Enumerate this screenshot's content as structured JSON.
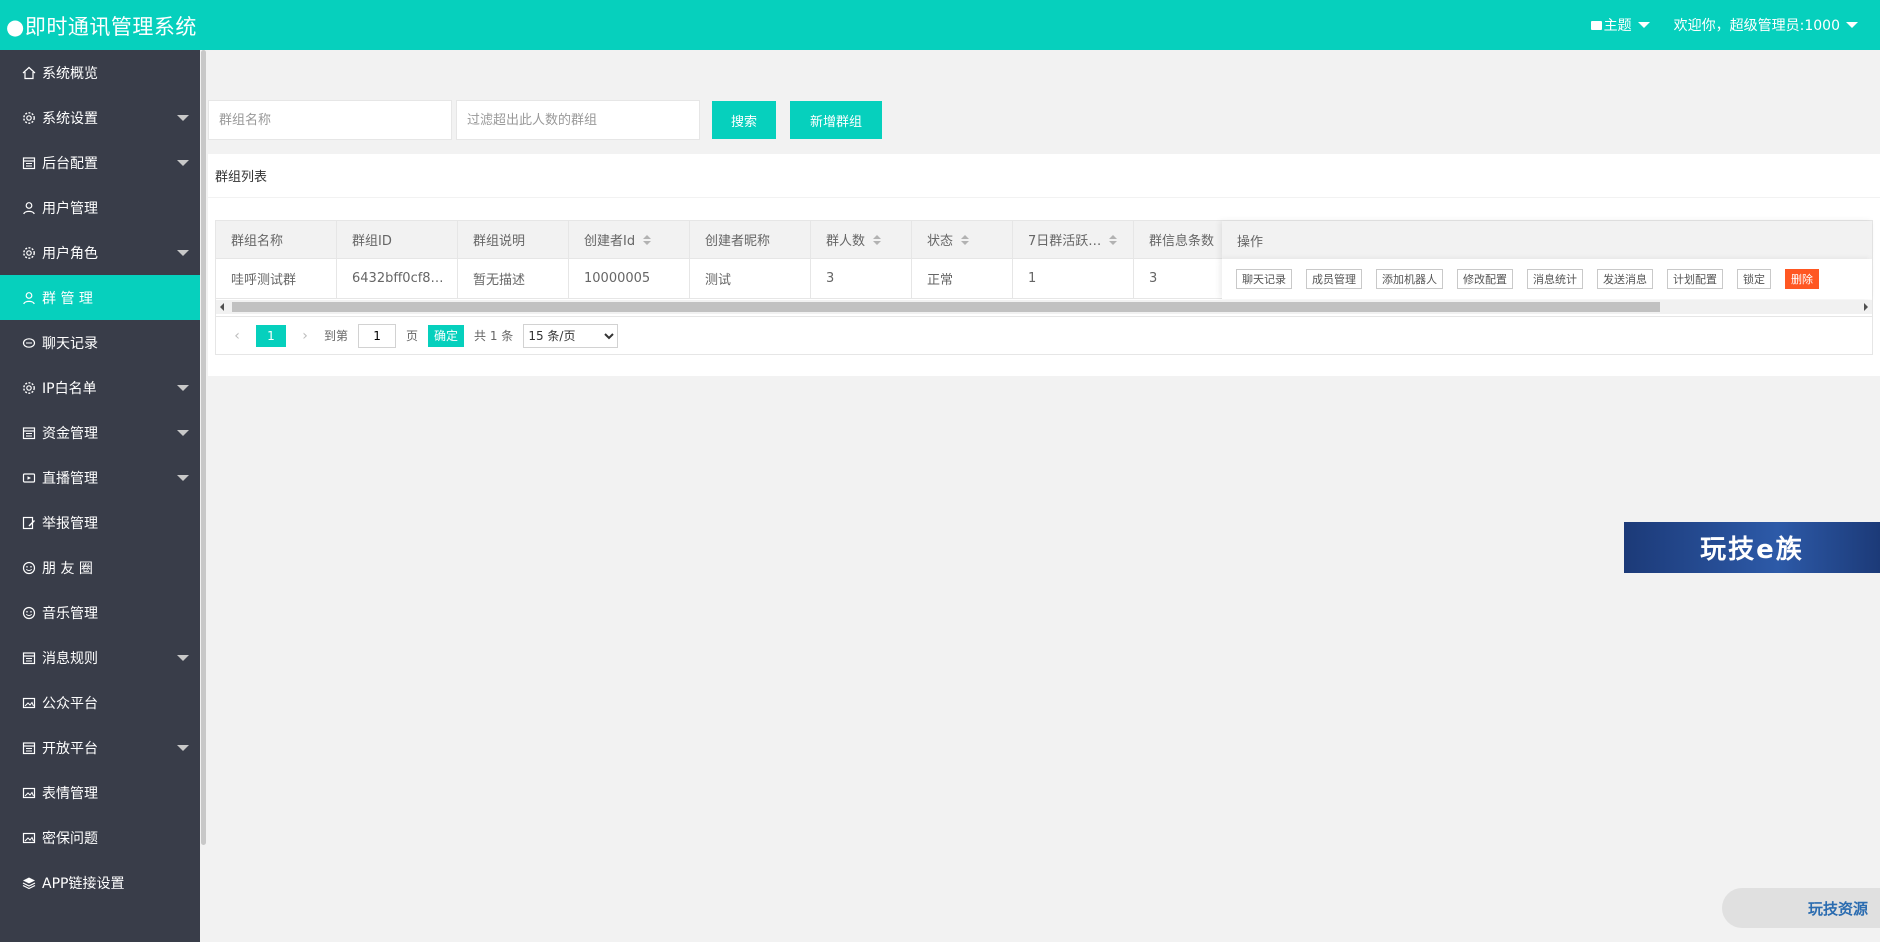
{
  "header": {
    "title": "●即时通讯管理系统",
    "theme_label": "主题",
    "user_label": "欢迎你，超级管理员:1000"
  },
  "sidebar": {
    "items": [
      {
        "label": "系统概览",
        "icon": "home-icon",
        "has_caret": false
      },
      {
        "label": "系统设置",
        "icon": "gear-icon",
        "has_caret": true
      },
      {
        "label": "后台配置",
        "icon": "calendar-icon",
        "has_caret": true
      },
      {
        "label": "用户管理",
        "icon": "user-icon",
        "has_caret": false
      },
      {
        "label": "用户角色",
        "icon": "gear-icon",
        "has_caret": true
      },
      {
        "label": "群 管 理",
        "icon": "user-icon",
        "has_caret": false,
        "active": true
      },
      {
        "label": "聊天记录",
        "icon": "chat-icon",
        "has_caret": false
      },
      {
        "label": "IP白名单",
        "icon": "gear-icon",
        "has_caret": true
      },
      {
        "label": "资金管理",
        "icon": "calendar-icon",
        "has_caret": true
      },
      {
        "label": "直播管理",
        "icon": "video-icon",
        "has_caret": true
      },
      {
        "label": "举报管理",
        "icon": "edit-icon",
        "has_caret": false
      },
      {
        "label": "朋 友 圈",
        "icon": "smile-icon",
        "has_caret": false
      },
      {
        "label": "音乐管理",
        "icon": "smile-icon",
        "has_caret": false
      },
      {
        "label": "消息规则",
        "icon": "calendar-icon",
        "has_caret": true
      },
      {
        "label": "公众平台",
        "icon": "image-icon",
        "has_caret": false
      },
      {
        "label": "开放平台",
        "icon": "calendar-icon",
        "has_caret": true
      },
      {
        "label": "表情管理",
        "icon": "image-icon",
        "has_caret": false
      },
      {
        "label": "密保问题",
        "icon": "image-icon",
        "has_caret": false
      },
      {
        "label": "APP链接设置",
        "icon": "layers-icon",
        "has_caret": false
      }
    ]
  },
  "search": {
    "name_placeholder": "群组名称",
    "filter_placeholder": "过滤超出此人数的群组",
    "search_label": "搜索",
    "add_label": "新增群组"
  },
  "table": {
    "caption": "群组列表",
    "columns": [
      "群组名称",
      "群组ID",
      "群组说明",
      "创建者Id",
      "创建者昵称",
      "群人数",
      "状态",
      "7日群活跃…",
      "群信息条数"
    ],
    "ops_header": "操作",
    "rows": [
      {
        "cells": [
          "哇呼测试群",
          "6432bff0cf8…",
          "暂无描述",
          "10000005",
          "测试",
          "3",
          "正常",
          "1",
          "3"
        ],
        "ops": [
          "聊天记录",
          "成员管理",
          "添加机器人",
          "修改配置",
          "消息统计",
          "发送消息",
          "计划配置",
          "锁定",
          "删除"
        ]
      }
    ]
  },
  "pager": {
    "current": "1",
    "jump_prefix": "到第",
    "jump_value": "1",
    "jump_suffix": "页",
    "confirm": "确定",
    "total": "共 1 条",
    "page_size": "15 条/页",
    "page_size_options": [
      "15 条/页"
    ]
  },
  "overlays": {
    "banner_text": "玩技e族",
    "watermark_text": "玩技资源"
  },
  "colors": {
    "accent": "#06d0bd",
    "sidebar_bg": "#393d49",
    "danger": "#ff5722"
  }
}
